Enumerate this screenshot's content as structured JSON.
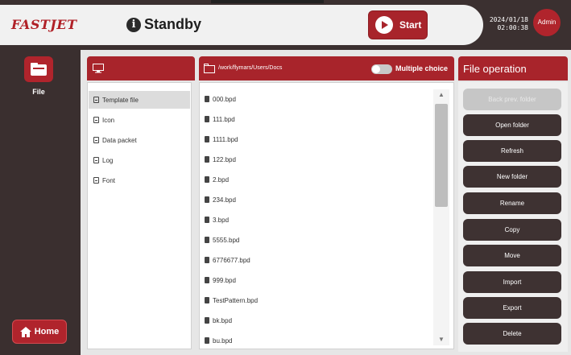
{
  "header": {
    "logo": "FASTJET",
    "status": "Standby",
    "start_label": "Start",
    "date": "2024/01/18",
    "time": "02:00:38",
    "user": "Admin"
  },
  "nav": {
    "file_label": "File",
    "home_label": "Home"
  },
  "tree": {
    "items": [
      "Template file",
      "Icon",
      "Data packet",
      "Log",
      "Font"
    ]
  },
  "list": {
    "path": "/work/flymars/Users/Docs",
    "multiple_choice_label": "Multiple choice",
    "files": [
      "000.bpd",
      "111.bpd",
      "1111.bpd",
      "122.bpd",
      "2.bpd",
      "234.bpd",
      "3.bpd",
      "5555.bpd",
      "6776677.bpd",
      "999.bpd",
      "TestPattern.bpd",
      "bk.bpd",
      "bu.bpd"
    ]
  },
  "operations": {
    "title": "File operation",
    "buttons": [
      "Back prev. folder",
      "Open folder",
      "Refresh",
      "New folder",
      "Rename",
      "Copy",
      "Move",
      "Import",
      "Export",
      "Delete"
    ]
  },
  "colors": {
    "accent": "#a8242b",
    "dark": "#3b3030",
    "panel": "#e6e6e6"
  }
}
